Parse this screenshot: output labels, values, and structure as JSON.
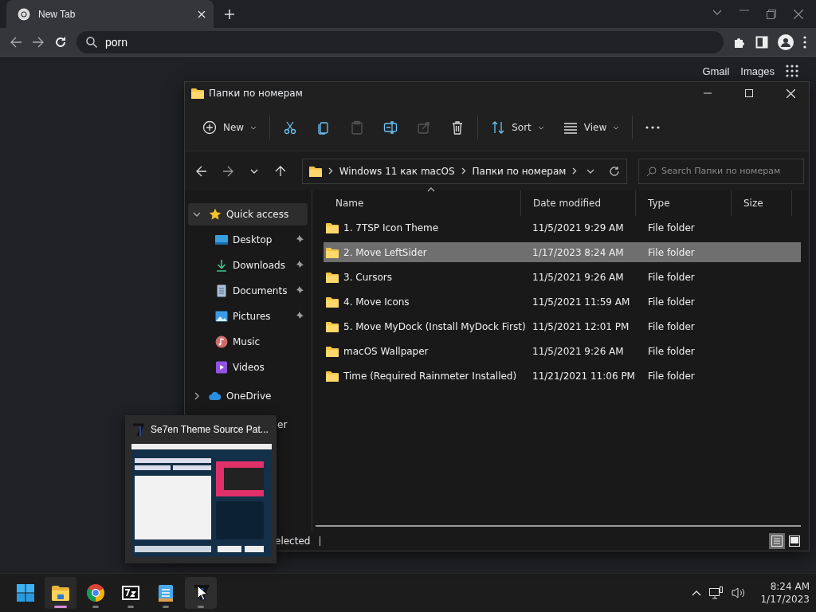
{
  "browser": {
    "tab": {
      "title": "New Tab"
    },
    "address": {
      "value": "porn"
    },
    "top_links": [
      "Gmail",
      "Images"
    ]
  },
  "explorer": {
    "title": "Папки по номерам",
    "toolbar": [
      {
        "kind": "new",
        "label": "New",
        "disabled": false
      },
      {
        "kind": "cut",
        "disabled": false
      },
      {
        "kind": "copy",
        "disabled": false
      },
      {
        "kind": "paste",
        "disabled": true
      },
      {
        "kind": "rename",
        "disabled": false
      },
      {
        "kind": "share",
        "disabled": true
      },
      {
        "kind": "delete",
        "disabled": false
      },
      {
        "kind": "sort",
        "label": "Sort",
        "disabled": false
      },
      {
        "kind": "view",
        "label": "View",
        "disabled": false
      },
      {
        "kind": "more",
        "disabled": false
      }
    ],
    "breadcrumb": [
      "Windows 11 как macOS",
      "Папки по номерам"
    ],
    "search": {
      "placeholder": "Search Папки по номерам"
    },
    "nav": [
      {
        "kind": "star",
        "label": "Quick access",
        "expanded": true,
        "selected": true,
        "children": [
          {
            "kind": "desktop",
            "label": "Desktop",
            "pinned": true
          },
          {
            "kind": "downloads",
            "label": "Downloads",
            "pinned": true
          },
          {
            "kind": "documents",
            "label": "Documents",
            "pinned": true
          },
          {
            "kind": "pictures",
            "label": "Pictures",
            "pinned": true
          },
          {
            "kind": "music",
            "label": "Music",
            "pinned": false
          },
          {
            "kind": "videos",
            "label": "Videos",
            "pinned": false
          }
        ]
      },
      {
        "kind": "cloud",
        "label": "OneDrive",
        "expanded": false,
        "selected": false
      },
      {
        "kind": "hidden",
        "label": "er",
        "selected": false
      }
    ],
    "columns": [
      "Name",
      "Date modified",
      "Type",
      "Size"
    ],
    "rows": [
      {
        "name": "1. 7TSP Icon Theme",
        "date": "11/5/2021 9:29 AM",
        "type": "File folder",
        "selected": false
      },
      {
        "name": "2. Move LeftSider",
        "date": "1/17/2023 8:24 AM",
        "type": "File folder",
        "selected": true
      },
      {
        "name": "3. Cursors",
        "date": "11/5/2021 9:26 AM",
        "type": "File folder",
        "selected": false
      },
      {
        "name": "4. Move Icons",
        "date": "11/5/2021 11:59 AM",
        "type": "File folder",
        "selected": false
      },
      {
        "name": "5. Move MyDock (Install MyDock First)",
        "date": "11/5/2021 12:01 PM",
        "type": "File folder",
        "selected": false
      },
      {
        "name": "macOS Wallpaper",
        "date": "11/5/2021 9:26 AM",
        "type": "File folder",
        "selected": false
      },
      {
        "name": "Time (Required Rainmeter Installed)",
        "date": "11/21/2021 11:06 PM",
        "type": "File folder",
        "selected": false
      }
    ],
    "status": "elected",
    "views": [
      {
        "kind": "details",
        "selected": true
      },
      {
        "kind": "tiles",
        "selected": false
      }
    ]
  },
  "preview": {
    "title": "Se7en Theme Source Pat..."
  },
  "taskbar": {
    "apps": [
      {
        "kind": "start",
        "active": false,
        "running": false,
        "hovered": false
      },
      {
        "kind": "explorer",
        "active": true,
        "running": true,
        "hovered": false
      },
      {
        "kind": "chrome",
        "active": false,
        "running": true,
        "hovered": false
      },
      {
        "kind": "archive",
        "active": false,
        "running": true,
        "hovered": false
      },
      {
        "kind": "notepad",
        "active": false,
        "running": true,
        "hovered": false
      },
      {
        "kind": "se7en",
        "active": false,
        "running": true,
        "hovered": true
      }
    ],
    "time": "8:24 AM",
    "date": "1/17/2023"
  }
}
